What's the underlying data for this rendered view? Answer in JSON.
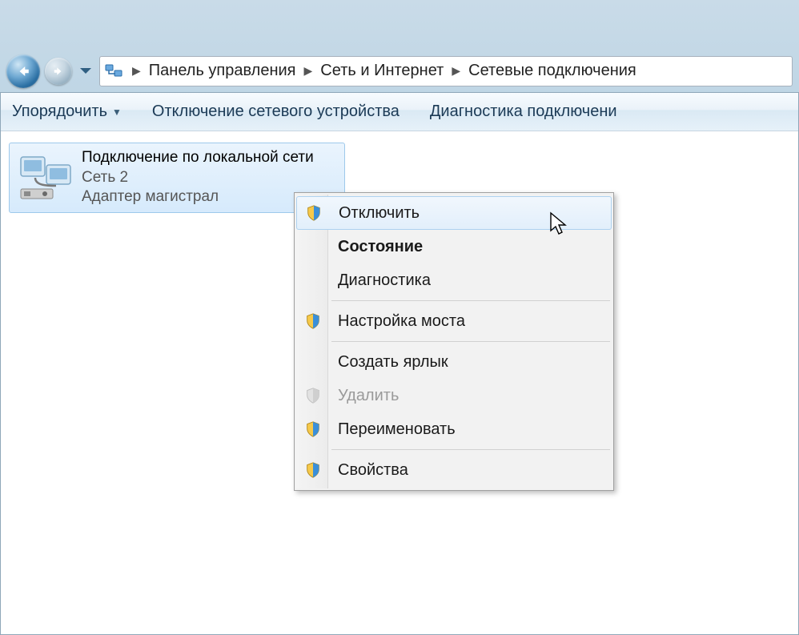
{
  "breadcrumb": {
    "items": [
      "Панель управления",
      "Сеть и Интернет",
      "Сетевые подключения"
    ]
  },
  "toolbar": {
    "organize": "Упорядочить",
    "disable_device": "Отключение сетевого устройства",
    "diagnose": "Диагностика подключени"
  },
  "connection": {
    "title": "Подключение по локальной сети",
    "network": "Сеть  2",
    "adapter": "Адаптер магистрал"
  },
  "context_menu": {
    "disable": "Отключить",
    "status": "Состояние",
    "diagnose": "Диагностика",
    "bridge": "Настройка моста",
    "shortcut": "Создать ярлык",
    "delete": "Удалить",
    "rename": "Переименовать",
    "properties": "Свойства"
  }
}
